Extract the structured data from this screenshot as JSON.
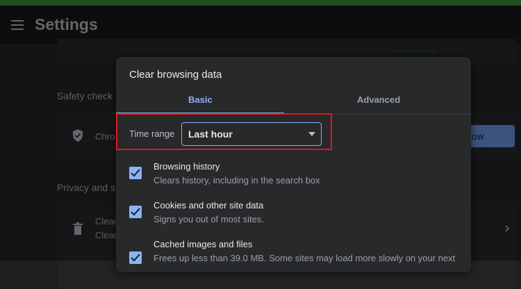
{
  "settings": {
    "title": "Settings",
    "safety_section": "Safety check",
    "safety_row_text": "Chro",
    "safety_button": "ck now",
    "privacy_section": "Privacy and s",
    "privacy_row_title": "Clear",
    "privacy_row_desc": "Clear"
  },
  "dialog": {
    "title": "Clear browsing data",
    "tabs": [
      {
        "label": "Basic",
        "active": true
      },
      {
        "label": "Advanced",
        "active": false
      }
    ],
    "time_range": {
      "label": "Time range",
      "value": "Last hour"
    },
    "options": [
      {
        "title": "Browsing history",
        "description": "Clears history, including in the search box",
        "checked": true
      },
      {
        "title": "Cookies and other site data",
        "description": "Signs you out of most sites.",
        "checked": true
      },
      {
        "title": "Cached images and files",
        "description": "Frees up less than 39.0 MB. Some sites may load more slowly on your next",
        "checked": true
      }
    ]
  },
  "colors": {
    "accent": "#8ab4f8",
    "highlight_box": "#e0161b",
    "dialog_bg": "#28292b",
    "page_bg": "#1f1f21"
  },
  "icons": [
    "menu-icon",
    "shield-icon",
    "trash-icon",
    "chevron-right-icon",
    "chevron-down-icon",
    "checkmark-icon"
  ]
}
